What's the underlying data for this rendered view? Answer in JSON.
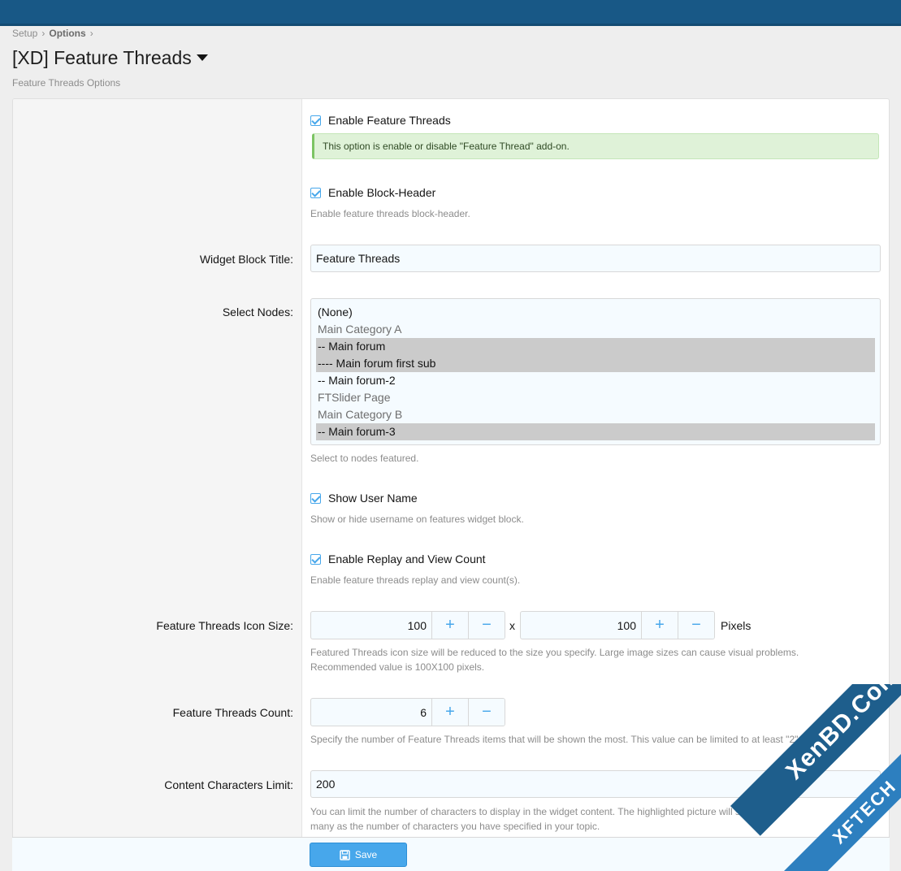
{
  "breadcrumb": {
    "items": [
      "Setup",
      "Options"
    ]
  },
  "page": {
    "title": "[XD] Feature Threads",
    "description": "Feature Threads Options"
  },
  "options": {
    "enable_feature_threads": {
      "label": "Enable Feature Threads",
      "checked": true,
      "notice": "This option is enable or disable \"Feature Thread\" add-on."
    },
    "enable_block_header": {
      "label": "Enable Block-Header",
      "checked": true,
      "hint": "Enable feature threads block-header."
    },
    "widget_block_title": {
      "label": "Widget Block Title:",
      "value": "Feature Threads"
    },
    "select_nodes": {
      "label": "Select Nodes:",
      "options": [
        {
          "text": "(None)",
          "selected": false,
          "dim": false
        },
        {
          "text": "Main Category A",
          "selected": false,
          "dim": true
        },
        {
          "text": "-- Main forum",
          "selected": true,
          "dim": false
        },
        {
          "text": "---- Main forum first sub",
          "selected": true,
          "dim": false
        },
        {
          "text": "-- Main forum-2",
          "selected": false,
          "dim": false
        },
        {
          "text": "FTSlider Page",
          "selected": false,
          "dim": true
        },
        {
          "text": "Main Category B",
          "selected": false,
          "dim": true
        },
        {
          "text": "-- Main forum-3",
          "selected": true,
          "dim": false
        }
      ],
      "hint": "Select to nodes featured."
    },
    "show_user_name": {
      "label": "Show User Name",
      "checked": true,
      "hint": "Show or hide username on features widget block."
    },
    "enable_replay_view_count": {
      "label": "Enable Replay and View Count",
      "checked": true,
      "hint": "Enable feature threads replay and view count(s)."
    },
    "icon_size": {
      "label": "Feature Threads Icon Size:",
      "width": "100",
      "height": "100",
      "separator": "x",
      "unit": "Pixels",
      "hint_line1": "Featured Threads icon size will be reduced to the size you specify. Large image sizes can cause visual problems.",
      "hint_line2": "Recommended value is 100X100 pixels."
    },
    "threads_count": {
      "label": "Feature Threads Count:",
      "value": "6",
      "hint": "Specify the number of Feature Threads items that will be shown the most. This value can be limited to at least \"2\" subj"
    },
    "content_limit": {
      "label": "Content Characters Limit:",
      "value": "200",
      "hint_line1": "You can limit the number of characters to display in the widget content. The highlighted picture will sh",
      "hint_line2": "many as the number of characters you have specified in your topic."
    }
  },
  "spinner": {
    "plus": "+",
    "minus": "−"
  },
  "footer": {
    "save_label": "Save"
  },
  "watermark": {
    "line1": "XenBD.Com",
    "line2": "XFTECH"
  },
  "colors": {
    "accent": "#47a7eb",
    "topbar": "#185886",
    "notice_bg": "#dff2d8"
  }
}
